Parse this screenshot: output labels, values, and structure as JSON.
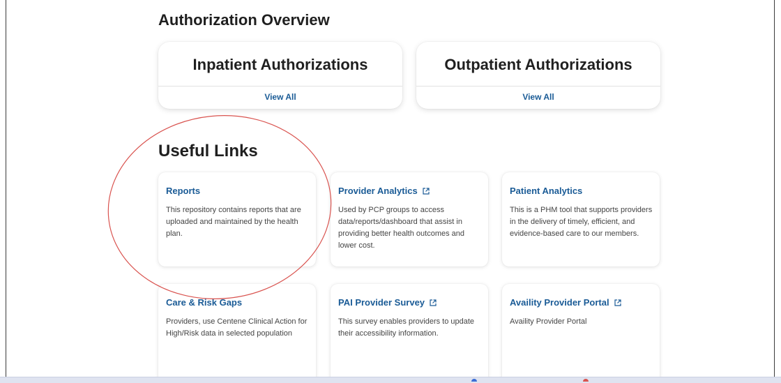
{
  "auth_overview": {
    "heading": "Authorization Overview",
    "cards": [
      {
        "title": "Inpatient Authorizations",
        "action": "View All"
      },
      {
        "title": "Outpatient Authorizations",
        "action": "View All"
      }
    ]
  },
  "useful_links": {
    "heading": "Useful Links",
    "cards": [
      {
        "title": "Reports",
        "external": false,
        "description": "This repository contains reports that are uploaded and maintained by the health plan."
      },
      {
        "title": "Provider Analytics",
        "external": true,
        "description": "Used by PCP groups to access data/reports/dashboard that assist in providing better health outcomes and lower cost."
      },
      {
        "title": "Patient Analytics",
        "external": false,
        "description": "This is a PHM tool that supports providers in the delivery of timely, efficient, and evidence-based care to our members."
      },
      {
        "title": "Care & Risk Gaps",
        "external": false,
        "description": "Providers, use Centene Clinical Action for High/Risk data in selected population"
      },
      {
        "title": "PAI Provider Survey",
        "external": true,
        "description": "This survey enables providers to update their accessibility information."
      },
      {
        "title": "Availity Provider Portal",
        "external": true,
        "description": "Availity Provider Portal"
      }
    ]
  },
  "colors": {
    "link_blue": "#1a5b96",
    "annotation_red": "#d9534f"
  }
}
